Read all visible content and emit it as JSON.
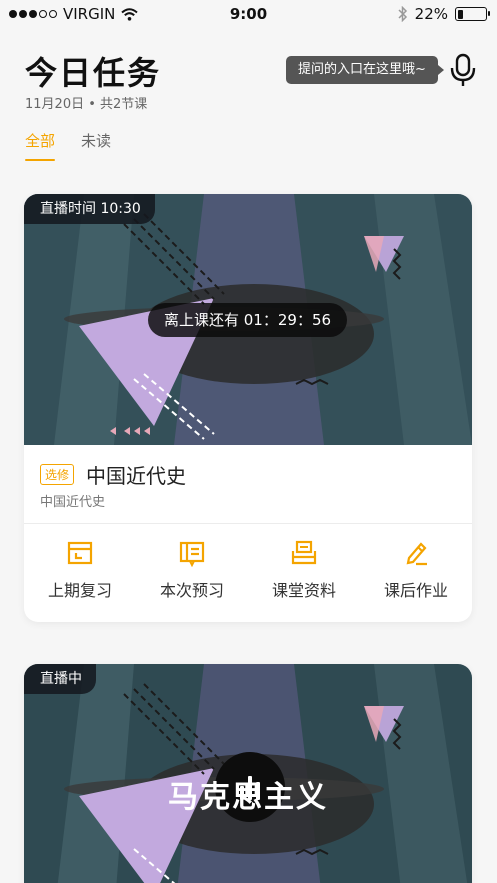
{
  "status_bar": {
    "carrier": "VIRGIN",
    "time": "9:00",
    "battery": "22%",
    "battery_level": 0.22
  },
  "header": {
    "title": "今日任务",
    "subtitle": "11月20日 • 共2节课",
    "tooltip": "提问的入口在这里哦~"
  },
  "tabs": [
    {
      "label": "全部",
      "active": true
    },
    {
      "label": "未读",
      "active": false
    }
  ],
  "cards": [
    {
      "badge": "直播时间 10:30",
      "countdown": "离上课还有 01：29：56",
      "tag": "选修",
      "title": "中国近代史",
      "subtitle": "中国近代史",
      "actions": [
        {
          "label": "上期复习",
          "icon": "review-icon"
        },
        {
          "label": "本次预习",
          "icon": "preview-icon"
        },
        {
          "label": "课堂资料",
          "icon": "materials-icon"
        },
        {
          "label": "课后作业",
          "icon": "homework-icon"
        }
      ]
    },
    {
      "badge": "直播中",
      "banner_title": "马克思主义"
    }
  ],
  "colors": {
    "accent": "#f4a400",
    "banner_bg": "#2f4a52",
    "purple": "#b9a3d6"
  }
}
